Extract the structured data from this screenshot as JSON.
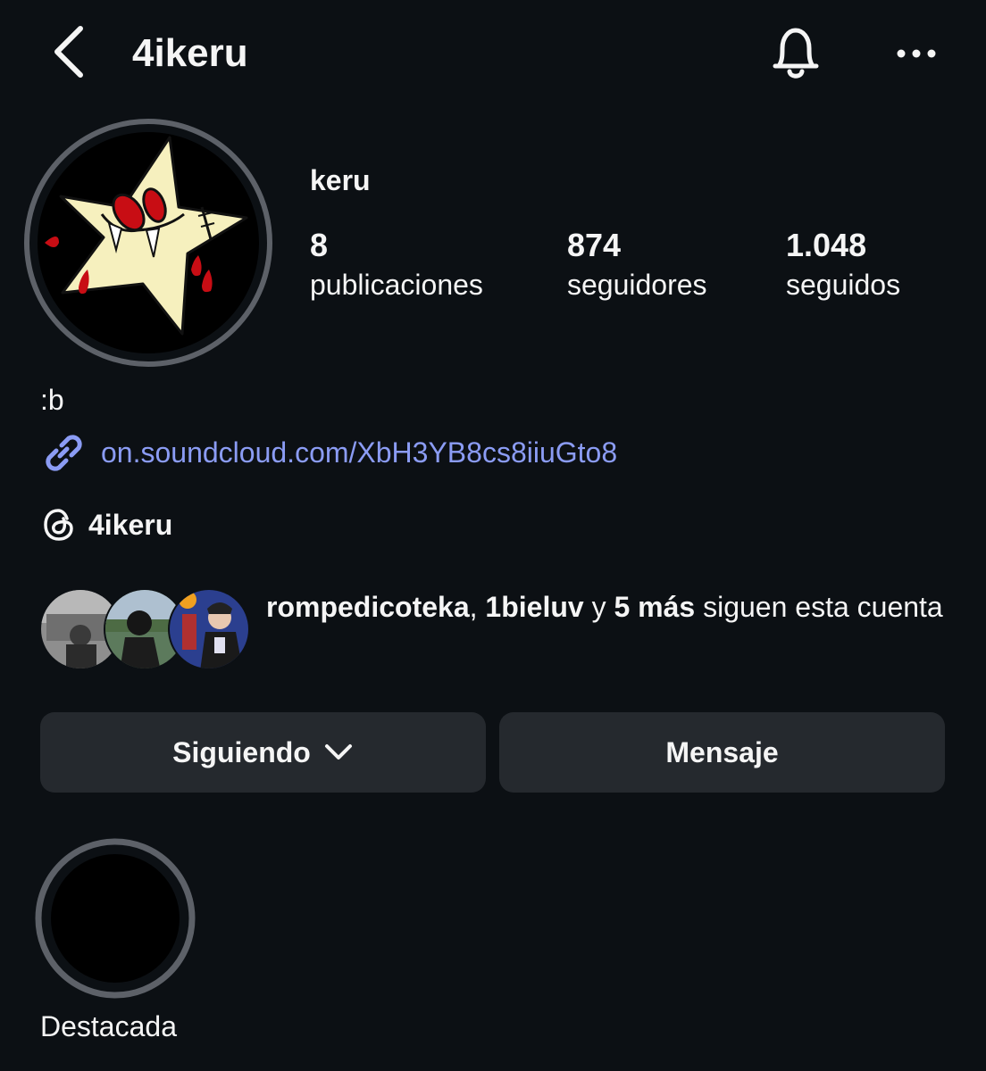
{
  "header": {
    "back_icon": "chevron-left-icon",
    "title": "4ikeru",
    "notifications_icon": "bell-icon",
    "menu_icon": "more-horizontal-icon"
  },
  "profile": {
    "display_name": "keru",
    "avatar_icon": "star-avatar-image",
    "stats": {
      "posts": {
        "value": "8",
        "label": "publicaciones"
      },
      "followers": {
        "value": "874",
        "label": "seguidores"
      },
      "following": {
        "value": "1.048",
        "label": "seguidos"
      }
    },
    "bio": ":b",
    "link": {
      "icon": "link-icon",
      "text": "on.soundcloud.com/XbH3YB8cs8iiuGto8"
    },
    "threads": {
      "icon": "threads-icon",
      "handle": "4ikeru"
    }
  },
  "mutual_followers": {
    "avatars": [
      "mutual-avatar-1",
      "mutual-avatar-2",
      "mutual-avatar-3"
    ],
    "user1": "rompedicoteka",
    "sep1": ", ",
    "user2": "1bieluv",
    "sep2": " y ",
    "more": "5 más",
    "suffix": " siguen esta cuenta"
  },
  "actions": {
    "following_label": "Siguiendo",
    "message_label": "Mensaje"
  },
  "highlights": [
    {
      "label": "Destacada"
    }
  ],
  "colors": {
    "background": "#0c1014",
    "button": "#25292e",
    "link": "#8b9cf4",
    "ring": "#5d6168",
    "text": "#f5f5f5"
  }
}
